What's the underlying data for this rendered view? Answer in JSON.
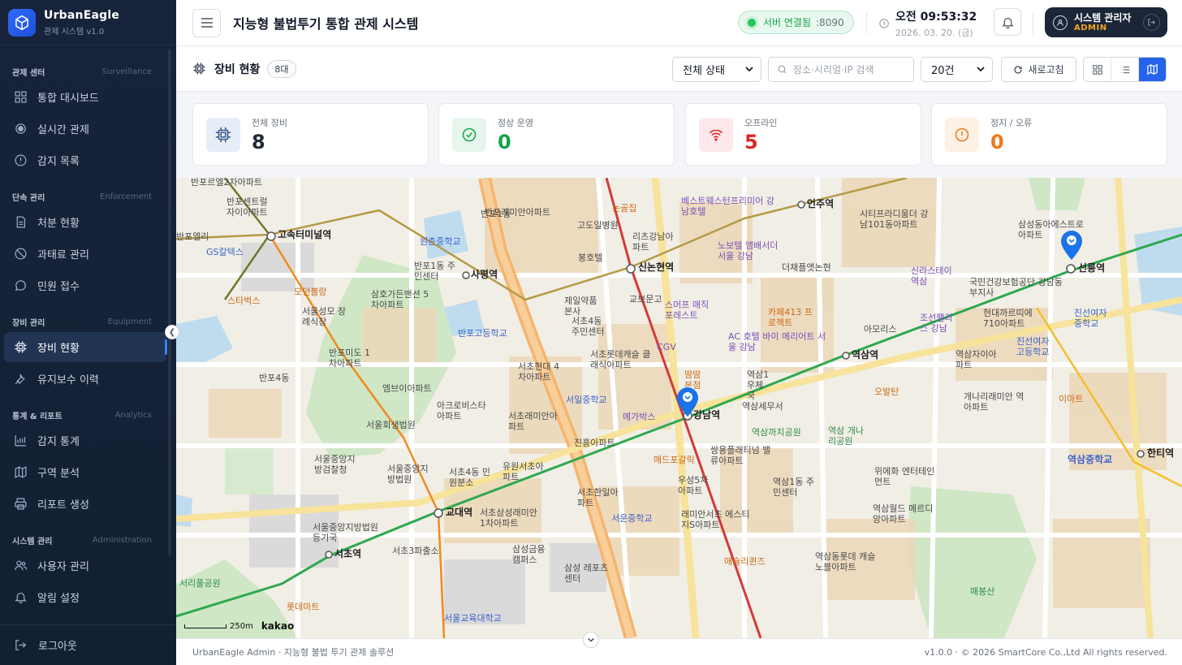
{
  "brand": {
    "name": "UrbanEagle",
    "sub": "관제 시스템 v1.0"
  },
  "sidebar": {
    "sections": [
      {
        "ko": "관제 센터",
        "en": "Surveillance",
        "items": [
          {
            "label": "통합 대시보드",
            "icon": "grid-icon"
          },
          {
            "label": "실시간 관제",
            "icon": "radio-dot-icon"
          },
          {
            "label": "감지 목록",
            "icon": "alert-circle-icon"
          }
        ]
      },
      {
        "ko": "단속 관리",
        "en": "Enforcement",
        "items": [
          {
            "label": "처분 현황",
            "icon": "document-icon"
          },
          {
            "label": "과태료 관리",
            "icon": "ban-icon"
          },
          {
            "label": "민원 접수",
            "icon": "chat-bubble-icon"
          }
        ]
      },
      {
        "ko": "장비 관리",
        "en": "Equipment",
        "items": [
          {
            "label": "장비 현황",
            "icon": "chip-icon",
            "active": true
          },
          {
            "label": "유지보수 이력",
            "icon": "wrench-icon"
          }
        ]
      },
      {
        "ko": "통계 & 리포트",
        "en": "Analytics",
        "items": [
          {
            "label": "감지 통계",
            "icon": "bar-chart-icon"
          },
          {
            "label": "구역 분석",
            "icon": "map-icon"
          },
          {
            "label": "리포트 생성",
            "icon": "printer-icon"
          }
        ]
      },
      {
        "ko": "시스템 관리",
        "en": "Administration",
        "items": [
          {
            "label": "사용자 관리",
            "icon": "users-icon"
          },
          {
            "label": "알림 설정",
            "icon": "bell-icon"
          }
        ]
      }
    ],
    "logout": "로그아웃"
  },
  "header": {
    "title": "지능형 불법투기 통합 관제 시스템",
    "server_status": "서버 연결됨",
    "server_port": ":8090",
    "time": "오전 09:53:32",
    "date": "2026. 03. 20. (금)",
    "user_name": "시스템 관리자",
    "user_role": "ADMIN"
  },
  "toolbar": {
    "title": "장비 현황",
    "count": "8대",
    "status_filter": "전체 상태",
    "search_placeholder": "장소·시리얼·IP 검색",
    "page_size": "20건",
    "refresh": "새로고침",
    "active_view": "map"
  },
  "stats": [
    {
      "label": "전체 장비",
      "value": "8",
      "color": "#1f2937",
      "icon": "chip-icon",
      "bg": "#e6edf7",
      "fg": "#3b5b8a"
    },
    {
      "label": "정상 운영",
      "value": "0",
      "color": "#16a34a",
      "icon": "check-circle-icon",
      "bg": "#e7f6ec",
      "fg": "#16a34a"
    },
    {
      "label": "오프라인",
      "value": "5",
      "color": "#dc2626",
      "icon": "wifi-icon",
      "bg": "#fde9ea",
      "fg": "#dc2626"
    },
    {
      "label": "정지 / 오류",
      "value": "0",
      "color": "#ea7a1a",
      "icon": "warning-circle-icon",
      "bg": "#fdf0e4",
      "fg": "#ea7a1a"
    }
  ],
  "map": {
    "labels": {
      "stations": [
        "고속터미널역",
        "신논현역",
        "사평역",
        "강남역",
        "교대역",
        "서초역",
        "역삼역",
        "선릉역",
        "언주역",
        "한티역",
        "역삼중학교"
      ],
      "buildings": [
        "반포르엘2차아파트",
        "반포센트럴자이아파트",
        "반포엘리",
        "반포2동",
        "반포1동",
        "반포래미안아파트",
        "반포1동 주민센터",
        "삼호가든맨션 5차아파트",
        "서울성모 장례식장",
        "반포미도 1차아파트",
        "엠브이아파트",
        "반포4동",
        "아크로비스타아파트",
        "서울회생법원",
        "서울중앙지방검찰청",
        "서울중앙지방법원",
        "서초4동 민원분소",
        "서울중앙지방법원 등기국",
        "서초3파출소",
        "삼성금융 캠퍼스",
        "삼성 레포츠센터",
        "서초한일아파트",
        "서초삼성래미안 1차아파트",
        "진흥아파트",
        "유원서초아파트",
        "서초현대 4차아파트",
        "서초래미안아파트",
        "서초롯데캐슬 클래식아파트",
        "제일약품 본사",
        "서초4동 주민센터",
        "교보문고",
        "고도일병원",
        "리츠강남아파트",
        "봉호텔",
        "역삼세무서",
        "쌍용플래티넘 밸류아파트",
        "우성5차아파트",
        "래미안서초 에스티지S아파트",
        "역삼1동 주민센터",
        "위에화 엔터테인먼트",
        "역삼월드 메르디앙아파트",
        "역삼동롯데 캐슬노블아파트",
        "역삼자이아파트",
        "개나리래미안 역아파트",
        "국민건강보험공단 강남동부지사",
        "현대까르띠에 710아파트",
        "삼성동아에스트로아파트",
        "시티프라디움더 강남101동아파트",
        "더채플앳논현",
        "아모리스",
        "역삼1 우체국"
      ],
      "pois_blue": [
        "GS칼텍스",
        "원촌중학교",
        "반포고등학교",
        "서일중학교",
        "서운중학교",
        "서울교육대학교",
        "진선여자중학교",
        "진선여자고등학교",
        "역삼중학교"
      ],
      "pois_orange": [
        "논골집",
        "스타벅스",
        "모던볼랑",
        "땀땀본점",
        "매드포갈릭",
        "카페413 프로젝트",
        "오발탄",
        "애슐리퀸즈",
        "롯데마트",
        "이마트"
      ],
      "pois_purple": [
        "베스트웨스턴프리미어 강남호텔",
        "노보텔 앰배서더 서울 강남",
        "스머프 매직포레스트",
        "CGV",
        "메가박스",
        "AC 호텔 바이 메리어트 서울 강남",
        "신라스테이 역삼",
        "조선팰리스 강남"
      ],
      "pois_green": [
        "역삼까치공원",
        "역삼 개나리공원",
        "서리풀공원",
        "매봉산"
      ],
      "scale": "250m",
      "provider": "kakao"
    },
    "markers": [
      "강남역",
      "선릉역"
    ]
  },
  "footer": {
    "left": "UrbanEagle Admin  ·  지능형 불법 투기 관제 솔루션",
    "right": "v1.0.0  ·  © 2026 SmartCore Co.,Ltd All rights reserved."
  }
}
